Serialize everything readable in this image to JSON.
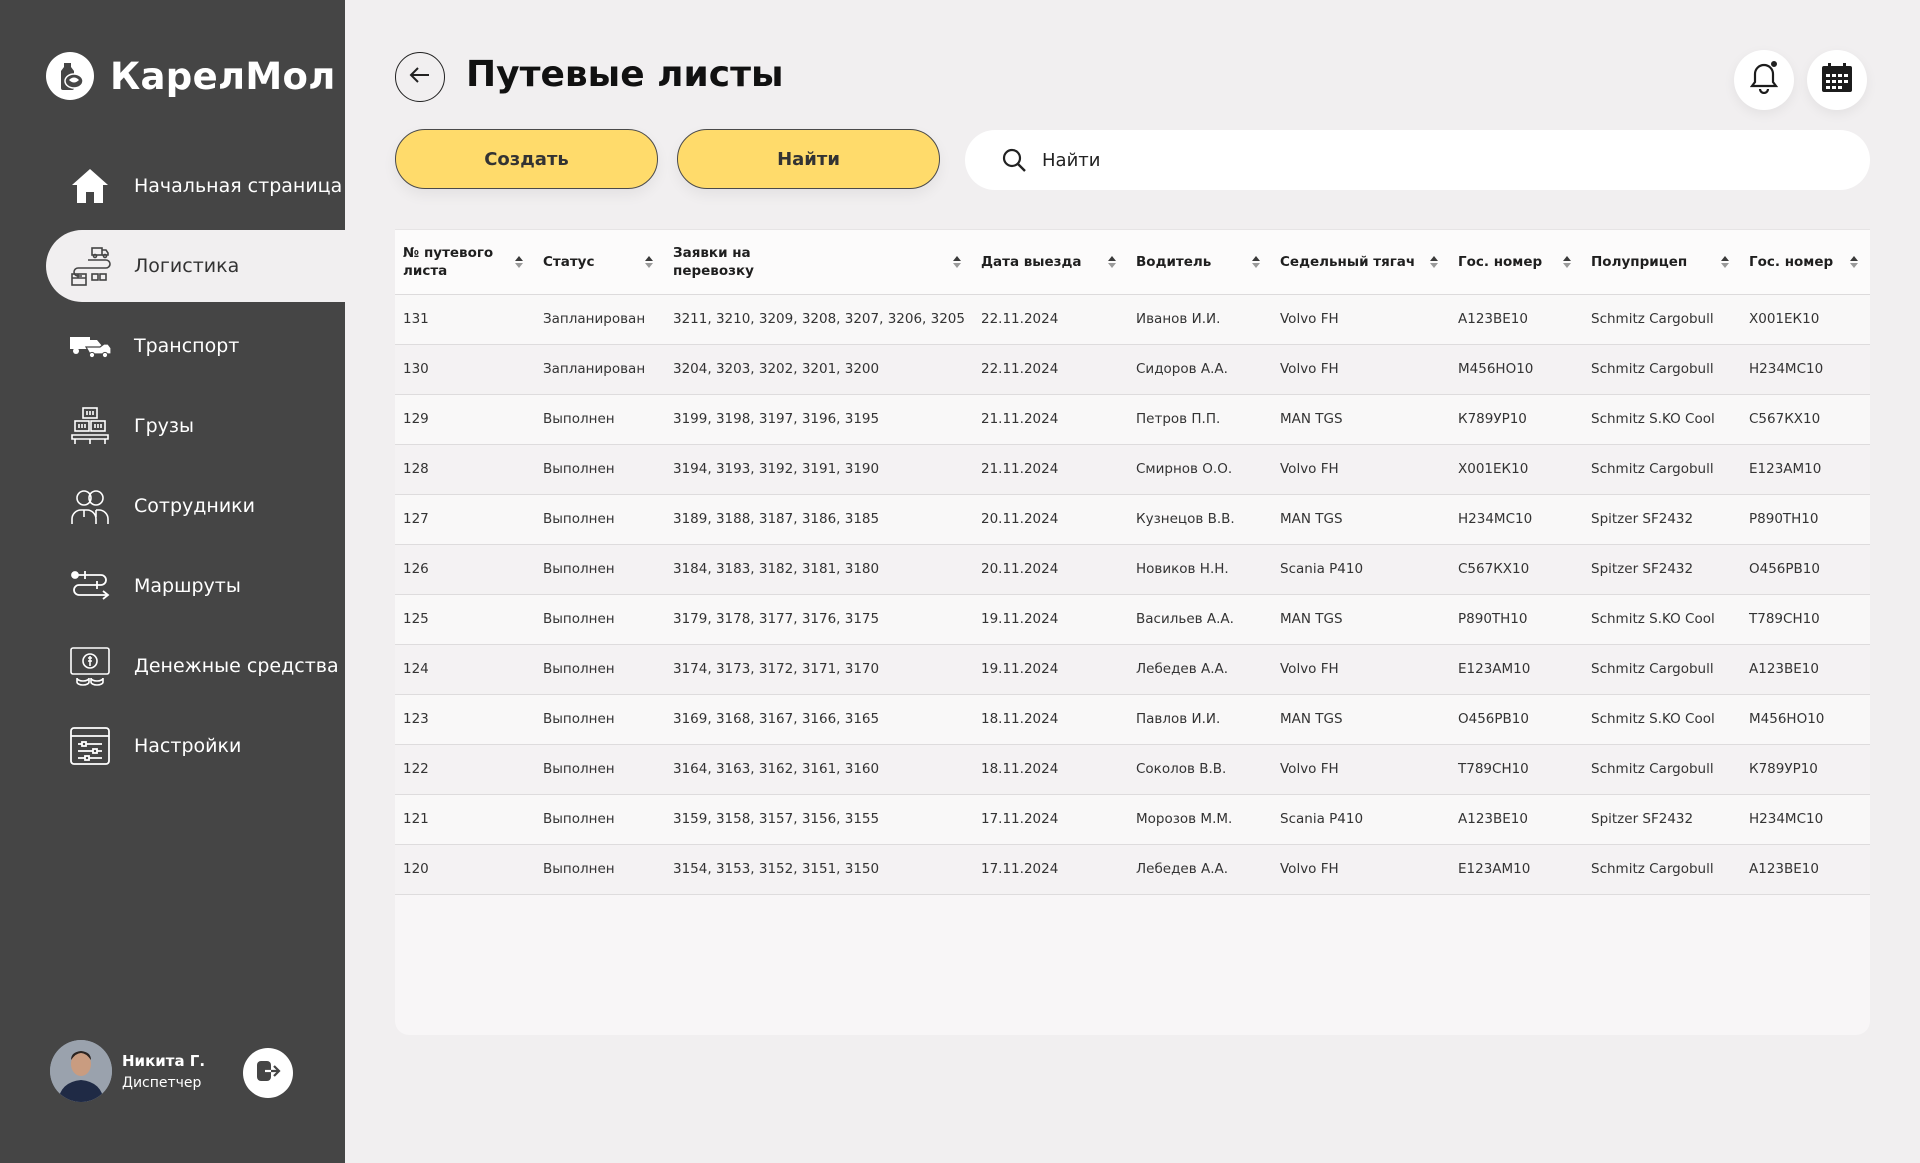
{
  "app": {
    "name": "КарелМол"
  },
  "sidebar": {
    "items": [
      {
        "label": "Начальная страница",
        "icon": "home-icon"
      },
      {
        "label": "Логистика",
        "icon": "logistics-icon",
        "active": true
      },
      {
        "label": "Транспорт",
        "icon": "truck-icon"
      },
      {
        "label": "Грузы",
        "icon": "cargo-icon"
      },
      {
        "label": "Сотрудники",
        "icon": "employees-icon"
      },
      {
        "label": "Маршруты",
        "icon": "routes-icon"
      },
      {
        "label": "Денежные средства",
        "icon": "money-icon"
      },
      {
        "label": "Настройки",
        "icon": "settings-icon"
      }
    ]
  },
  "user": {
    "name": "Никита Г.",
    "role": "Диспетчер"
  },
  "header": {
    "title": "Путевые листы"
  },
  "toolbar": {
    "create_label": "Создать",
    "find_label": "Найти",
    "search_placeholder": "Найти"
  },
  "colors": {
    "accent": "#ffdb6b",
    "sidebar": "#454545",
    "background": "#f1eff0"
  },
  "table": {
    "columns": [
      "№ путевого листа",
      "Статус",
      "Заявки на перевозку",
      "Дата выезда",
      "Водитель",
      "Седельный тягач",
      "Гос. номер",
      "Полуприцеп",
      "Гос. номер"
    ],
    "rows": [
      [
        "131",
        "Запланирован",
        "3211, 3210, 3209, 3208, 3207, 3206, 3205",
        "22.11.2024",
        "Иванов И.И.",
        "Volvo FH",
        "А123ВЕ10",
        "Schmitz Cargobull",
        "Х001ЕК10"
      ],
      [
        "130",
        "Запланирован",
        "3204, 3203, 3202, 3201, 3200",
        "22.11.2024",
        "Сидоров А.А.",
        "Volvo FH",
        "М456НО10",
        "Schmitz Cargobull",
        "Н234МС10"
      ],
      [
        "129",
        "Выполнен",
        "3199, 3198, 3197, 3196, 3195",
        "21.11.2024",
        "Петров П.П.",
        "MAN TGS",
        "К789УР10",
        "Schmitz S.KO Cool",
        "С567КХ10"
      ],
      [
        "128",
        "Выполнен",
        "3194, 3193, 3192, 3191, 3190",
        "21.11.2024",
        "Смирнов О.О.",
        "Volvo FH",
        "Х001ЕК10",
        "Schmitz Cargobull",
        "Е123АМ10"
      ],
      [
        "127",
        "Выполнен",
        "3189, 3188, 3187, 3186, 3185",
        "20.11.2024",
        "Кузнецов В.В.",
        "MAN TGS",
        "Н234МС10",
        "Spitzer SF2432",
        "Р890ТН10"
      ],
      [
        "126",
        "Выполнен",
        "3184, 3183, 3182, 3181, 3180",
        "20.11.2024",
        "Новиков Н.Н.",
        "Scania P410",
        "С567КХ10",
        "Spitzer SF2432",
        "О456РВ10"
      ],
      [
        "125",
        "Выполнен",
        "3179, 3178, 3177, 3176, 3175",
        "19.11.2024",
        "Васильев А.А.",
        "MAN TGS",
        "Р890ТН10",
        "Schmitz S.KO Cool",
        "Т789СН10"
      ],
      [
        "124",
        "Выполнен",
        "3174, 3173, 3172, 3171, 3170",
        "19.11.2024",
        "Лебедев А.А.",
        "Volvo FH",
        "Е123АМ10",
        "Schmitz Cargobull",
        "А123ВЕ10"
      ],
      [
        "123",
        "Выполнен",
        "3169, 3168, 3167, 3166, 3165",
        "18.11.2024",
        "Павлов И.И.",
        "MAN TGS",
        "О456РВ10",
        "Schmitz S.KO Cool",
        "М456НО10"
      ],
      [
        "122",
        "Выполнен",
        "3164, 3163, 3162, 3161, 3160",
        "18.11.2024",
        "Соколов В.В.",
        "Volvo FH",
        "Т789СН10",
        "Schmitz Cargobull",
        "К789УР10"
      ],
      [
        "121",
        "Выполнен",
        "3159, 3158, 3157, 3156, 3155",
        "17.11.2024",
        "Морозов М.М.",
        "Scania P410",
        "А123ВЕ10",
        "Spitzer SF2432",
        "Н234МС10"
      ],
      [
        "120",
        "Выполнен",
        "3154, 3153, 3152, 3151, 3150",
        "17.11.2024",
        "Лебедев А.А.",
        "Volvo FH",
        "Е123АМ10",
        "Schmitz Cargobull",
        "А123ВЕ10"
      ]
    ]
  }
}
